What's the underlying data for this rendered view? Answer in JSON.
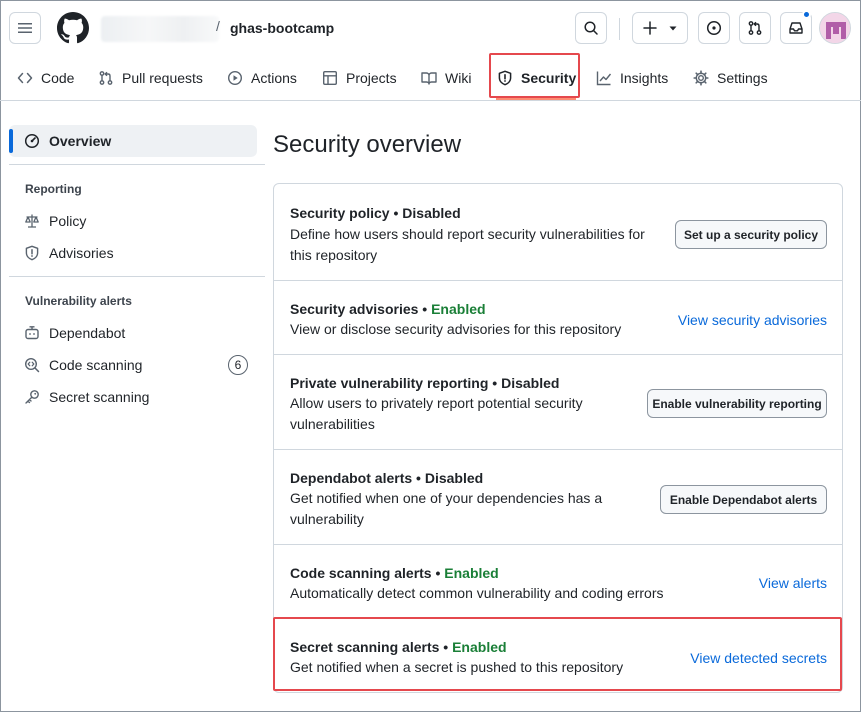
{
  "header": {
    "repo_separator": "/",
    "repo_name": "ghas-bootcamp",
    "icons": [
      "hamburger-icon",
      "github-logo-icon",
      "search-icon",
      "plus-icon",
      "issues-icon",
      "pull-request-icon",
      "inbox-icon",
      "avatar"
    ]
  },
  "tabs": [
    {
      "label": "Code",
      "icon": "code-icon"
    },
    {
      "label": "Pull requests",
      "icon": "git-pull-request-icon"
    },
    {
      "label": "Actions",
      "icon": "play-icon"
    },
    {
      "label": "Projects",
      "icon": "table-icon"
    },
    {
      "label": "Wiki",
      "icon": "book-icon"
    },
    {
      "label": "Security",
      "icon": "shield-icon",
      "selected": true
    },
    {
      "label": "Insights",
      "icon": "graph-icon"
    },
    {
      "label": "Settings",
      "icon": "gear-icon"
    }
  ],
  "sidebar": {
    "overview": "Overview",
    "reporting_heading": "Reporting",
    "policy": "Policy",
    "advisories": "Advisories",
    "vuln_heading": "Vulnerability alerts",
    "dependabot": "Dependabot",
    "code_scanning": "Code scanning",
    "code_scanning_count": "6",
    "secret_scanning": "Secret scanning"
  },
  "main": {
    "title": "Security overview",
    "rows": [
      {
        "title": "Security policy",
        "status": "Disabled",
        "desc": "Define how users should report security vulnerabilities for this repository",
        "action": "Set up a security policy",
        "action_type": "button"
      },
      {
        "title": "Security advisories",
        "status": "Enabled",
        "desc": "View or disclose security advisories for this repository",
        "action": "View security advisories",
        "action_type": "link"
      },
      {
        "title": "Private vulnerability reporting",
        "status": "Disabled",
        "desc": "Allow users to privately report potential security vulnerabilities",
        "action": "Enable vulnerability reporting",
        "action_type": "button"
      },
      {
        "title": "Dependabot alerts",
        "status": "Disabled",
        "desc": "Get notified when one of your dependencies has a vulnerability",
        "action": "Enable Dependabot alerts",
        "action_type": "button"
      },
      {
        "title": "Code scanning alerts",
        "status": "Enabled",
        "desc": "Automatically detect common vulnerability and coding errors",
        "action": "View alerts",
        "action_type": "link"
      },
      {
        "title": "Secret scanning alerts",
        "status": "Enabled",
        "desc": "Get notified when a secret is pushed to this repository",
        "action": "View detected secrets",
        "action_type": "link"
      }
    ]
  },
  "colors": {
    "enabled": "#1a7f37",
    "link": "#0969da",
    "highlight": "#e5484d",
    "tab_underline": "#fd8c73"
  }
}
